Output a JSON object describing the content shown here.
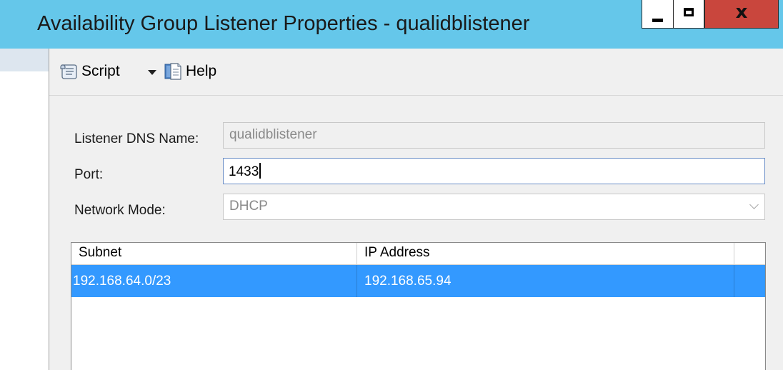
{
  "window": {
    "title": "Availability Group Listener Properties - qualidblistener",
    "close_glyph": "x"
  },
  "toolbar": {
    "script_label": "Script",
    "help_label": "Help"
  },
  "form": {
    "dns_label": "Listener DNS Name:",
    "dns_value": "qualidblistener",
    "port_label": "Port:",
    "port_value": "1433",
    "mode_label": "Network Mode:",
    "mode_value": "DHCP"
  },
  "grid": {
    "columns": [
      "Subnet",
      "IP Address"
    ],
    "rows": [
      {
        "subnet": "192.168.64.0/23",
        "ip": "192.168.65.94",
        "selected": true
      }
    ]
  },
  "colors": {
    "titlebar": "#65c7ea",
    "close_button": "#c9463d",
    "selection": "#3399ff"
  },
  "icons": {
    "minimize": "minimize-icon",
    "maximize": "maximize-icon",
    "close": "close-icon",
    "script": "script-icon",
    "dropdown": "chevron-down-icon",
    "help": "help-icon"
  }
}
